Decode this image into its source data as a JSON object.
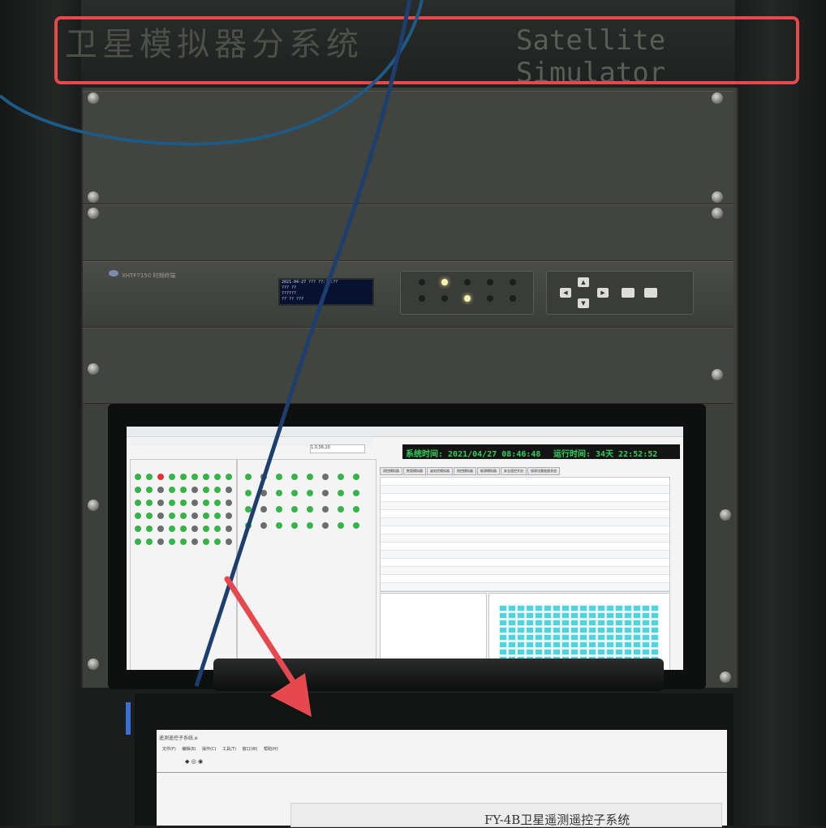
{
  "cabinet": {
    "title_cn": "卫星模拟器分系统",
    "title_en": "Satellite Simulator"
  },
  "device": {
    "label": "XHTF7150 时频终端",
    "lcd_lines": [
      "2021-04-27 ??? ??:??:??",
      "??? ??",
      "??????",
      "?? ?? ???"
    ],
    "leds": [
      false,
      true,
      false,
      false,
      false,
      false,
      false,
      true,
      false,
      false
    ],
    "keypad": [
      "▲",
      "◀",
      "▶",
      "▼"
    ]
  },
  "monitor": {
    "system_time": "系统时间: 2021/04/27 08:46:48",
    "run_time": "运行时间: 34天 22:52:52",
    "field_value": "1,0,36,10",
    "tabs": [
      "测控模拟器",
      "数管模拟器",
      "姿轨控模拟器",
      "热控模拟器",
      "能源模拟器",
      "安全遥控开启",
      "接收设备链路状态"
    ],
    "indicator_colors": [
      "green",
      "green",
      "red",
      "green",
      "green",
      "green",
      "green",
      "green",
      "green"
    ]
  },
  "laptop": {
    "window_title": "遥测遥控子系统.e",
    "menu": "文件(F) 编辑(E) 操作(C) 工具(T) 窗口(W) 帮助(H)",
    "heading": "FY-4B卫星遥测遥控子系统"
  },
  "annotations": {
    "highlight_color": "#e5484d",
    "arrow_color": "#e5484d"
  }
}
